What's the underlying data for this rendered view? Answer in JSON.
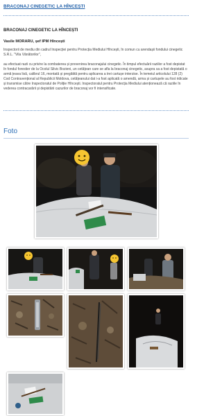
{
  "header": {
    "title": "BRACONAJ CINEGETIC LA HÎNCEȘTI"
  },
  "article": {
    "title": "BRACONAJ CINEGETIC LA HÎNCEȘTI",
    "author": "Vasile MORARU, șef IPM Hîncești",
    "paragraph1": "Inspectorii de mediu din cadrul Inspecției pentru Protecția Mediului Hîncești, în comun cu arendașii fondului cinegetic S.R.L. \"Vila Vânătorilor\",",
    "paragraph2": "au efectuat razii cu privire la combaterea și prevenirea braconajului cinegetic. În timpul efectuării raziilor a fost depistat în fondul forestier de la Ocolul Silvic Bozieni, un cetățean care se afla la braconaj cinegetic, asupra sa a fost depistată o armă țeava lisă, calibrul 16, montată și pregătită pentru aplicarea a trei cartușe interzise. În temeiul articolului 128 (2) Cod Contravențional al Republicii Moldova, cetățeanului dat i-a fost aplicată o amendă, arma și cartușele au fost ridicate și transmise către Inspectoratul de Poliție Hîncești. Inspectoratul pentru Protecția Mediului atenționează că raziile în vederea contracarării și depistării cazurilor de braconaj vor fi intensificate."
  },
  "gallery": {
    "heading": "Foto"
  }
}
